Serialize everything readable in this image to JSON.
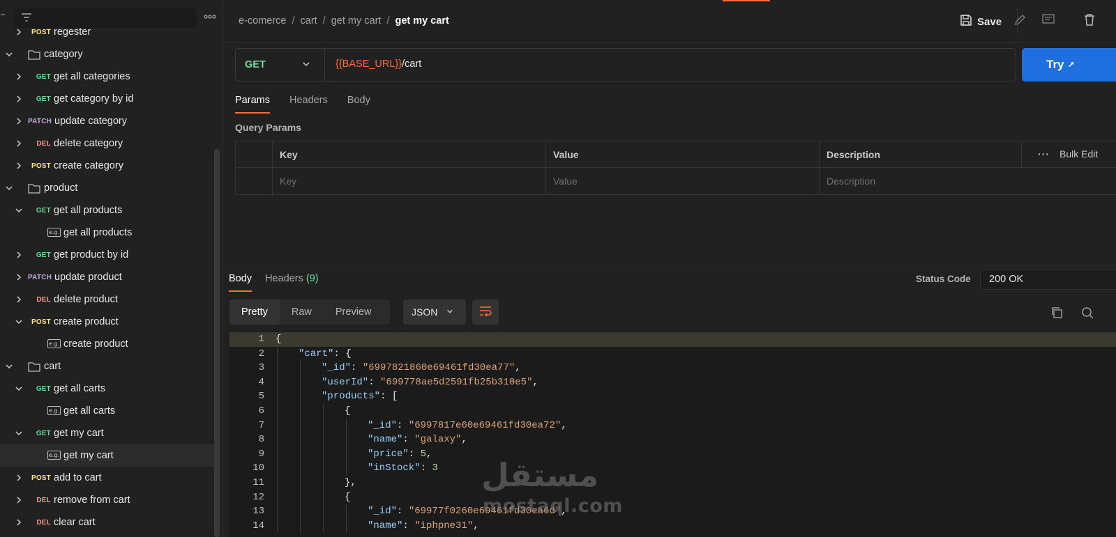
{
  "sidebar": {
    "filter_icon": "filter-icon",
    "more_icon": "more-icon",
    "items": [
      {
        "type": "request",
        "method": "POST",
        "label": "regester",
        "chevron": "right"
      },
      {
        "type": "folder",
        "label": "category",
        "chevron": "down"
      },
      {
        "type": "request",
        "method": "GET",
        "label": "get all categories",
        "chevron": "right"
      },
      {
        "type": "request",
        "method": "GET",
        "label": "get category by id",
        "chevron": "right"
      },
      {
        "type": "request",
        "method": "PATCH",
        "label": "update category",
        "chevron": "right"
      },
      {
        "type": "request",
        "method": "DEL",
        "label": "delete category",
        "chevron": "right"
      },
      {
        "type": "request",
        "method": "POST",
        "label": "create category",
        "chevron": "right"
      },
      {
        "type": "folder",
        "label": "product",
        "chevron": "down"
      },
      {
        "type": "request",
        "method": "GET",
        "label": "get all products",
        "chevron": "down"
      },
      {
        "type": "example",
        "label": "get all products"
      },
      {
        "type": "request",
        "method": "GET",
        "label": "get product by id",
        "chevron": "right"
      },
      {
        "type": "request",
        "method": "PATCH",
        "label": "update product",
        "chevron": "right"
      },
      {
        "type": "request",
        "method": "DEL",
        "label": "delete product",
        "chevron": "right"
      },
      {
        "type": "request",
        "method": "POST",
        "label": "create product",
        "chevron": "down"
      },
      {
        "type": "example",
        "label": "create product"
      },
      {
        "type": "folder",
        "label": "cart",
        "chevron": "down"
      },
      {
        "type": "request",
        "method": "GET",
        "label": "get all carts",
        "chevron": "down"
      },
      {
        "type": "example",
        "label": "get all carts"
      },
      {
        "type": "request",
        "method": "GET",
        "label": "get my cart",
        "chevron": "down"
      },
      {
        "type": "example",
        "label": "get my cart",
        "selected": true
      },
      {
        "type": "request",
        "method": "POST",
        "label": "add to cart",
        "chevron": "right"
      },
      {
        "type": "request",
        "method": "DEL",
        "label": "remove from cart",
        "chevron": "right"
      },
      {
        "type": "request",
        "method": "DEL",
        "label": "clear cart",
        "chevron": "right"
      }
    ],
    "example_badge": "e.g."
  },
  "breadcrumb": {
    "items": [
      "e-comerce",
      "cart",
      "get my cart"
    ],
    "current": "get my cart",
    "separator": "/"
  },
  "toolbar": {
    "save_label": "Save",
    "save_icon": "save-icon",
    "edit_icon": "pencil-icon",
    "comment_icon": "comment-icon",
    "delete_icon": "trash-icon"
  },
  "request": {
    "method": "GET",
    "url_var": "{{BASE_URL}}",
    "url_path": "/cart",
    "try_label": "Try",
    "tabs": [
      "Params",
      "Headers",
      "Body"
    ],
    "active_tab": "Params",
    "query_params_title": "Query Params",
    "table": {
      "headers": [
        "Key",
        "Value",
        "Description"
      ],
      "placeholders": [
        "Key",
        "Value",
        "Description"
      ],
      "bulk_edit_label": "Bulk Edit"
    }
  },
  "response": {
    "tabs": [
      "Body",
      "Headers"
    ],
    "headers_count": "(9)",
    "status_label": "Status Code",
    "status_value": "200 OK",
    "view_tabs": [
      "Pretty",
      "Raw",
      "Preview"
    ],
    "active_view": "Pretty",
    "format": "JSON",
    "copy_icon": "copy-icon",
    "search_icon": "search-icon",
    "wrap_icon": "wrap-lines-icon"
  },
  "code_lines": [
    {
      "n": "1",
      "indent": 0,
      "parts": [
        [
          "p",
          "{"
        ]
      ]
    },
    {
      "n": "2",
      "indent": 1,
      "parts": [
        [
          "k",
          "\"cart\""
        ],
        [
          "p",
          ": {"
        ]
      ]
    },
    {
      "n": "3",
      "indent": 2,
      "parts": [
        [
          "k",
          "\"_id\""
        ],
        [
          "p",
          ": "
        ],
        [
          "s",
          "\"6997821860e69461fd30ea77\""
        ],
        [
          "p",
          ","
        ]
      ]
    },
    {
      "n": "4",
      "indent": 2,
      "parts": [
        [
          "k",
          "\"userId\""
        ],
        [
          "p",
          ": "
        ],
        [
          "s",
          "\"699778ae5d2591fb25b310e5\""
        ],
        [
          "p",
          ","
        ]
      ]
    },
    {
      "n": "5",
      "indent": 2,
      "parts": [
        [
          "k",
          "\"products\""
        ],
        [
          "p",
          ": ["
        ]
      ]
    },
    {
      "n": "6",
      "indent": 3,
      "parts": [
        [
          "p",
          "{"
        ]
      ]
    },
    {
      "n": "7",
      "indent": 4,
      "parts": [
        [
          "k",
          "\"_id\""
        ],
        [
          "p",
          ": "
        ],
        [
          "s",
          "\"6997817e60e69461fd30ea72\""
        ],
        [
          "p",
          ","
        ]
      ]
    },
    {
      "n": "8",
      "indent": 4,
      "parts": [
        [
          "k",
          "\"name\""
        ],
        [
          "p",
          ": "
        ],
        [
          "s",
          "\"galaxy\""
        ],
        [
          "p",
          ","
        ]
      ]
    },
    {
      "n": "9",
      "indent": 4,
      "parts": [
        [
          "k",
          "\"price\""
        ],
        [
          "p",
          ": "
        ],
        [
          "n",
          "5"
        ],
        [
          "p",
          ","
        ]
      ]
    },
    {
      "n": "10",
      "indent": 4,
      "parts": [
        [
          "k",
          "\"inStock\""
        ],
        [
          "p",
          ": "
        ],
        [
          "n",
          "3"
        ]
      ]
    },
    {
      "n": "11",
      "indent": 3,
      "parts": [
        [
          "p",
          "},"
        ]
      ]
    },
    {
      "n": "12",
      "indent": 3,
      "parts": [
        [
          "p",
          "{"
        ]
      ]
    },
    {
      "n": "13",
      "indent": 4,
      "parts": [
        [
          "k",
          "\"_id\""
        ],
        [
          "p",
          ": "
        ],
        [
          "s",
          "\"69977f0260e69461fd30ea6d\""
        ],
        [
          "p",
          ","
        ]
      ]
    },
    {
      "n": "14",
      "indent": 4,
      "parts": [
        [
          "k",
          "\"name\""
        ],
        [
          "p",
          ": "
        ],
        [
          "s",
          "\"iphpne31\""
        ],
        [
          "p",
          ","
        ]
      ]
    }
  ],
  "watermark": {
    "arabic": "مستقل",
    "latin": "mostaql.com"
  },
  "colors": {
    "accent": "#ff6c37",
    "get": "#6bdd9a",
    "post": "#ffe47e",
    "patch": "#c0a8e1",
    "del": "#f79a8e",
    "primary_button": "#1f6fe0"
  }
}
